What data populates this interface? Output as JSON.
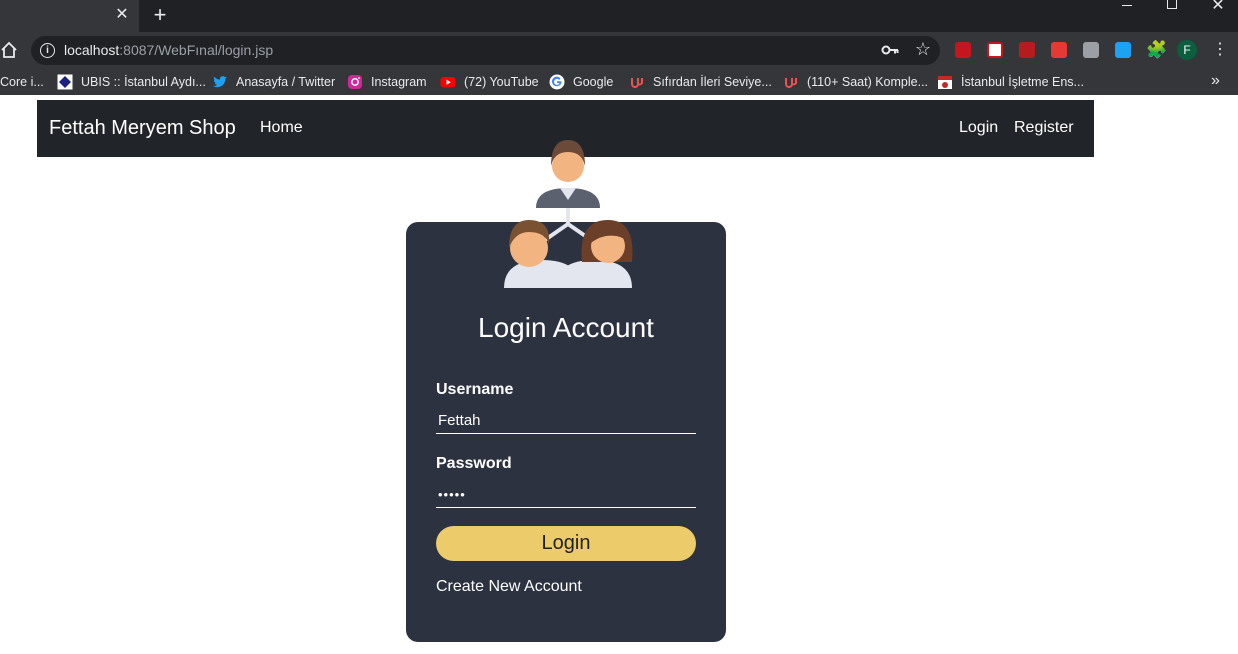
{
  "browser": {
    "tab_close_glyph": "✕",
    "new_tab_glyph": "+",
    "window_close_glyph": "✕",
    "url_host": "localhost",
    "url_path": ":8087/WebFınal/login.jsp",
    "star_glyph": "☆",
    "puzzle_glyph": "🧩",
    "profile_initial": "F",
    "menu_glyph": "⋮",
    "overflow_glyph": "»",
    "bookmarks": [
      {
        "label": "Core i...",
        "icon": "none"
      },
      {
        "label": "UBIS :: İstanbul Aydı...",
        "icon": "ubis-icon"
      },
      {
        "label": "Anasayfa / Twitter",
        "icon": "twitter-icon"
      },
      {
        "label": "Instagram",
        "icon": "instagram-icon"
      },
      {
        "label": "(72) YouTube",
        "icon": "youtube-icon"
      },
      {
        "label": "Google",
        "icon": "google-icon"
      },
      {
        "label": "Sıfırdan İleri Seviye...",
        "icon": "udemy-icon"
      },
      {
        "label": "(110+ Saat) Komple...",
        "icon": "udemy-icon"
      },
      {
        "label": "İstanbul İşletme Ens...",
        "icon": "calendar-icon"
      }
    ]
  },
  "navbar": {
    "brand": "Fettah Meryem Shop",
    "home": "Home",
    "login": "Login",
    "register": "Register"
  },
  "login_form": {
    "title": "Login Account",
    "username_label": "Username",
    "username_value": "Fettah",
    "password_label": "Password",
    "password_value": "•••••",
    "submit_label": "Login",
    "create_account_label": "Create New Account"
  },
  "colors": {
    "navbar_bg": "#212529",
    "card_bg": "#2d3240",
    "button_bg": "#eccb6a",
    "browser_dark": "#202124",
    "browser_toolbar": "#35363a"
  }
}
